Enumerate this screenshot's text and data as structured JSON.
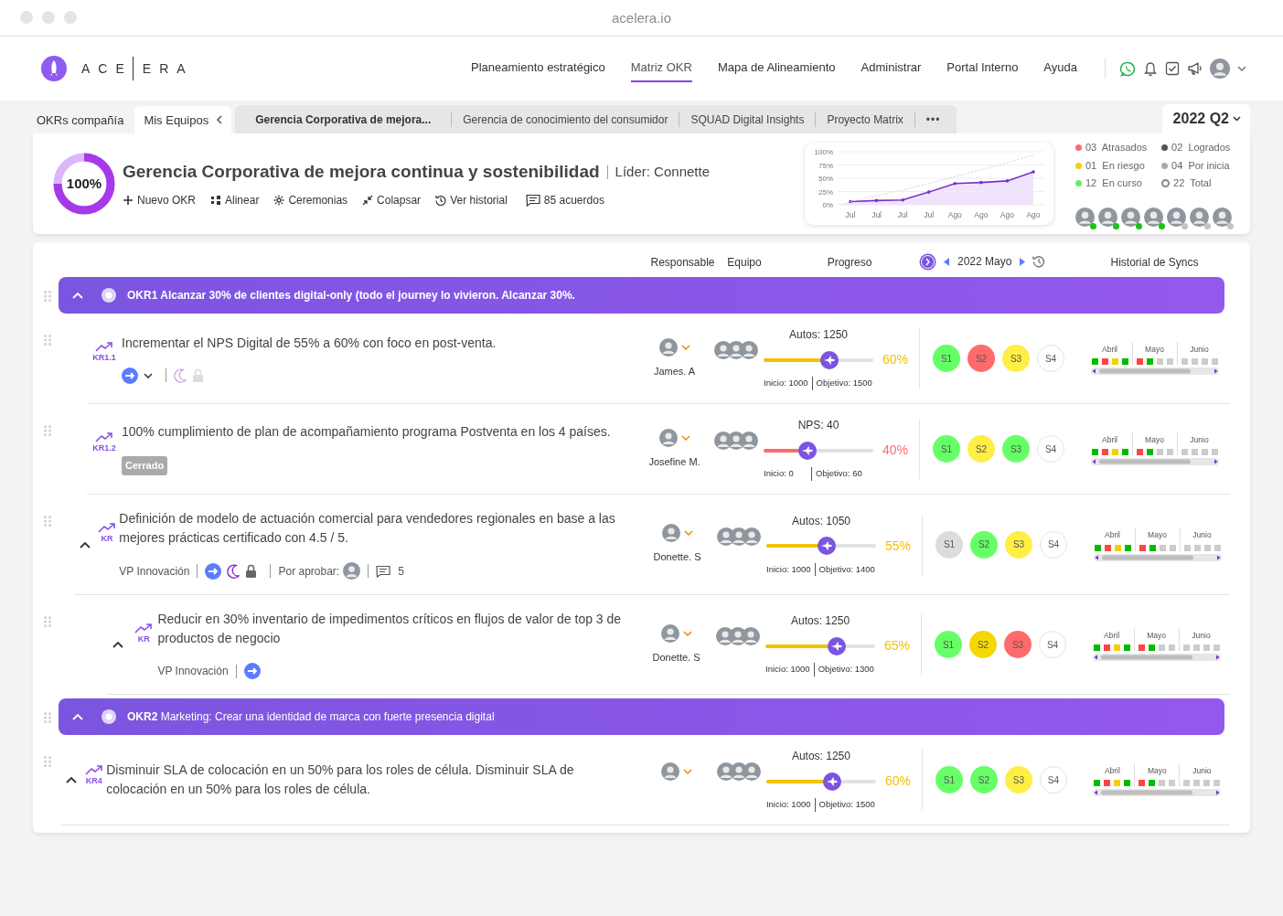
{
  "browser": {
    "title": "acelera.io"
  },
  "brand": {
    "left": "ACE",
    "right": "ERA"
  },
  "nav": [
    {
      "label": "Planeamiento estratégico",
      "selected": false
    },
    {
      "label": "Matriz OKR",
      "selected": true
    },
    {
      "label": "Mapa de Alineamiento",
      "selected": false
    },
    {
      "label": "Administrar",
      "selected": false
    },
    {
      "label": "Portal Interno",
      "selected": false
    },
    {
      "label": "Ayuda",
      "selected": false
    }
  ],
  "tabs": [
    {
      "label": "OKRs compañía",
      "selected": false
    },
    {
      "label": "Mis Equipos",
      "selected": true
    }
  ],
  "team_tabs": [
    {
      "label": "Gerencia Corporativa de mejora...",
      "selected": true
    },
    {
      "label": "Gerencia de conocimiento del consumidor",
      "selected": false
    },
    {
      "label": "SQUAD Digital Insights",
      "selected": false
    },
    {
      "label": "Proyecto Matrix",
      "selected": false
    }
  ],
  "more_tabs": "•••",
  "quarter": "2022 Q2",
  "team": {
    "progress": "100%",
    "name": "Gerencia Corporativa de mejora continua y sostenibilidad",
    "leader": "Líder: Connette",
    "actions": [
      {
        "kind": "add",
        "label": "Nuevo OKR"
      },
      {
        "kind": "align",
        "label": "Alinear"
      },
      {
        "kind": "ceremonies",
        "label": "Ceremonias"
      },
      {
        "kind": "collapse",
        "label": "Colapsar"
      },
      {
        "kind": "history",
        "label": "Ver historial"
      },
      {
        "kind": "agreements",
        "label": "85 acuerdos"
      }
    ],
    "chart_data": {
      "type": "line",
      "categories": [
        "Jul",
        "Jul",
        "Jul",
        "Jul",
        "Ago",
        "Ago",
        "Ago",
        "Ago"
      ],
      "ylim": [
        0,
        100
      ],
      "yticks": [
        {
          "value": 0,
          "label": "0%"
        },
        {
          "value": 25,
          "label": "25%"
        },
        {
          "value": 50,
          "label": "50%"
        },
        {
          "value": 75,
          "label": "75%"
        },
        {
          "value": 100,
          "label": "100%"
        }
      ],
      "grid": true,
      "series": [
        {
          "color": "#7b2fd0",
          "line_style": "solid",
          "values": [
            6,
            8,
            9,
            24,
            40,
            42,
            45,
            62
          ]
        },
        {
          "color": "#d4d4d4",
          "line_style": "dashed",
          "values": [
            6,
            17,
            28,
            40,
            53,
            66,
            79,
            94
          ]
        }
      ]
    },
    "stats": [
      {
        "kind": "dot",
        "count": "03",
        "label": "Atrasados",
        "color": "#ff6b6b"
      },
      {
        "kind": "dot",
        "count": "02",
        "label": "Logrados",
        "color": "#555555"
      },
      {
        "kind": "dot",
        "count": "01",
        "label": "En riesgo",
        "color": "#f5d000"
      },
      {
        "kind": "dot",
        "count": "04",
        "label": "Por inicia",
        "color": "#aaaaaa"
      },
      {
        "kind": "dot",
        "count": "12",
        "label": "En curso",
        "color": "#66ee66"
      },
      {
        "kind": "ring",
        "count": "22",
        "label": "Total",
        "color": "#888888"
      }
    ],
    "members": [
      {
        "online": true
      },
      {
        "online": true
      },
      {
        "online": true
      },
      {
        "online": true
      },
      {
        "online": false
      },
      {
        "online": false
      },
      {
        "online": false
      }
    ]
  },
  "columns": {
    "owner": "Responsable",
    "team": "Equipo",
    "progress": "Progreso",
    "period": "2022 Mayo",
    "history": "Historial de Syncs"
  },
  "okrs": [
    {
      "code": "OKR1",
      "title": "Alcanzar 30% de clientes digital-only (todo el journey lo vivieron. Alcanzar 30%.",
      "title_bold": true,
      "expanded": true,
      "krs": [
        {
          "kind": "leaf",
          "code": "KR1.1",
          "title": "Incrementar el NPS Digital de 55% a 60% con foco en post-venta.",
          "tools": [
            {
              "kind": "flow"
            },
            {
              "kind": "caret"
            },
            {
              "kind": "moon",
              "active": false
            },
            {
              "kind": "lock",
              "active": false
            }
          ],
          "owner": "James. A",
          "metric": "Autos: 1250",
          "level": 0.6,
          "percent": "60%",
          "color": "#f2c200",
          "start": "Inicio: 1000",
          "target": "Objetivo: 1500",
          "syncs": [
            {
              "label": "S1",
              "color": "#66ff66"
            },
            {
              "label": "S2",
              "color": "#ff6b6b"
            },
            {
              "label": "S3",
              "color": "#ffee44"
            },
            {
              "label": "S4",
              "color": "#ffffff"
            }
          ],
          "history": [
            {
              "month": "Abril",
              "weeks": [
                {
                  "color": "#00bb00"
                },
                {
                  "color": "#ff4444"
                },
                {
                  "color": "#f5d000"
                },
                {
                  "color": "#00bb00"
                }
              ]
            },
            {
              "month": "Mayo",
              "weeks": [
                {
                  "color": "#ff4444"
                },
                {
                  "color": "#00bb00"
                },
                {
                  "color": "#cccccc"
                },
                {
                  "color": "#cccccc"
                }
              ]
            },
            {
              "month": "Junio",
              "weeks": [
                {
                  "color": "#cccccc"
                },
                {
                  "color": "#cccccc"
                },
                {
                  "color": "#cccccc"
                },
                {
                  "color": "#cccccc"
                }
              ]
            }
          ]
        },
        {
          "kind": "leaf",
          "code": "KR1.2",
          "title": "100% cumplimiento de plan de acompañamiento programa Postventa en los 4 países.",
          "badge": "Cerrado",
          "owner": "Josefine M.",
          "metric": "NPS: 40",
          "level": 0.4,
          "percent": "40%",
          "color": "#ff6b6b",
          "start": "Inicio: 0",
          "target": "Objetivo: 60",
          "syncs": [
            {
              "label": "S1",
              "color": "#66ff66"
            },
            {
              "label": "S2",
              "color": "#ffee44"
            },
            {
              "label": "S3",
              "color": "#66ff66"
            },
            {
              "label": "S4",
              "color": "#ffffff"
            }
          ],
          "history": [
            {
              "month": "Abril",
              "weeks": [
                {
                  "color": "#00bb00"
                },
                {
                  "color": "#ff4444"
                },
                {
                  "color": "#f5d000"
                },
                {
                  "color": "#00bb00"
                }
              ]
            },
            {
              "month": "Mayo",
              "weeks": [
                {
                  "color": "#ff4444"
                },
                {
                  "color": "#00bb00"
                },
                {
                  "color": "#cccccc"
                },
                {
                  "color": "#cccccc"
                }
              ]
            },
            {
              "month": "Junio",
              "weeks": [
                {
                  "color": "#cccccc"
                },
                {
                  "color": "#cccccc"
                },
                {
                  "color": "#cccccc"
                },
                {
                  "color": "#cccccc"
                }
              ]
            }
          ]
        },
        {
          "kind": "parent",
          "expanded": true,
          "code": "KR",
          "title": "Definición de modelo de actuación comercial para vendedores regionales en base a las mejores prácticas certificado con 4.5 / 5.",
          "team_label": "VP Innovación",
          "tools": [
            {
              "kind": "flow"
            },
            {
              "kind": "moon",
              "active": true
            },
            {
              "kind": "lock",
              "active": true
            }
          ],
          "approver_label": "Por aprobar:",
          "comments": "5",
          "owner": "Donette. S",
          "metric": "Autos: 1050",
          "level": 0.55,
          "percent": "55%",
          "color": "#f2c200",
          "start": "Inicio: 1000",
          "target": "Objetivo: 1400",
          "syncs": [
            {
              "label": "S1",
              "color": "#dddddd"
            },
            {
              "label": "S2",
              "color": "#66ff66"
            },
            {
              "label": "S3",
              "color": "#ffee44"
            },
            {
              "label": "S4",
              "color": "#ffffff"
            }
          ],
          "history": [
            {
              "month": "Abril",
              "weeks": [
                {
                  "color": "#00bb00"
                },
                {
                  "color": "#ff4444"
                },
                {
                  "color": "#f5d000"
                },
                {
                  "color": "#00bb00"
                }
              ]
            },
            {
              "month": "Mayo",
              "weeks": [
                {
                  "color": "#ff4444"
                },
                {
                  "color": "#00bb00"
                },
                {
                  "color": "#cccccc"
                },
                {
                  "color": "#cccccc"
                }
              ]
            },
            {
              "month": "Junio",
              "weeks": [
                {
                  "color": "#cccccc"
                },
                {
                  "color": "#cccccc"
                },
                {
                  "color": "#cccccc"
                },
                {
                  "color": "#cccccc"
                }
              ]
            }
          ],
          "children": [
            {
              "kind": "parent",
              "expanded": true,
              "code": "KR",
              "title": "Reducir en 30% inventario de impedimentos críticos en flujos de valor de top 3 de productos de negocio",
              "team_label": "VP Innovación",
              "tools": [
                {
                  "kind": "flow"
                }
              ],
              "owner": "Donette. S",
              "metric": "Autos: 1250",
              "level": 0.65,
              "percent": "65%",
              "color": "#f2c200",
              "start": "Inicio: 1000",
              "target": "Objetivo: 1300",
              "syncs": [
                {
                  "label": "S1",
                  "color": "#66ff66"
                },
                {
                  "label": "S2",
                  "color": "#f5d800"
                },
                {
                  "label": "S3",
                  "color": "#ff6b6b"
                },
                {
                  "label": "S4",
                  "color": "#ffffff"
                }
              ],
              "history": [
                {
                  "month": "Abril",
                  "weeks": [
                    {
                      "color": "#00bb00"
                    },
                    {
                      "color": "#ff4444"
                    },
                    {
                      "color": "#f5d000"
                    },
                    {
                      "color": "#00bb00"
                    }
                  ]
                },
                {
                  "month": "Mayo",
                  "weeks": [
                    {
                      "color": "#ff4444"
                    },
                    {
                      "color": "#00bb00"
                    },
                    {
                      "color": "#cccccc"
                    },
                    {
                      "color": "#cccccc"
                    }
                  ]
                },
                {
                  "month": "Junio",
                  "weeks": [
                    {
                      "color": "#cccccc"
                    },
                    {
                      "color": "#cccccc"
                    },
                    {
                      "color": "#cccccc"
                    },
                    {
                      "color": "#cccccc"
                    }
                  ]
                }
              ]
            }
          ]
        }
      ]
    },
    {
      "code": "OKR2",
      "title": "Marketing: Crear una identidad de marca con fuerte presencia digital",
      "title_bold": false,
      "expanded": true,
      "krs": [
        {
          "kind": "parent",
          "expanded": true,
          "code": "KR4",
          "title": "Disminuir SLA de colocación en un 50% para los roles de célula. Disminuir SLA de colocación en un 50% para los roles de célula.",
          "metric": "Autos: 1250",
          "level": 0.6,
          "percent": "60%",
          "color": "#f2c200",
          "start": "Inicio: 1000",
          "target": "Objetivo: 1500",
          "syncs": [
            {
              "label": "S1",
              "color": "#66ff66"
            },
            {
              "label": "S2",
              "color": "#66ff66"
            },
            {
              "label": "S3",
              "color": "#ffee44"
            },
            {
              "label": "S4",
              "color": "#ffffff"
            }
          ],
          "history": [
            {
              "month": "Abril",
              "weeks": [
                {
                  "color": "#00bb00"
                },
                {
                  "color": "#ff4444"
                },
                {
                  "color": "#f5d000"
                },
                {
                  "color": "#00bb00"
                }
              ]
            },
            {
              "month": "Mayo",
              "weeks": [
                {
                  "color": "#ff4444"
                },
                {
                  "color": "#00bb00"
                },
                {
                  "color": "#cccccc"
                },
                {
                  "color": "#cccccc"
                }
              ]
            },
            {
              "month": "Junio",
              "weeks": [
                {
                  "color": "#cccccc"
                },
                {
                  "color": "#cccccc"
                },
                {
                  "color": "#cccccc"
                },
                {
                  "color": "#cccccc"
                }
              ]
            }
          ]
        }
      ]
    }
  ]
}
